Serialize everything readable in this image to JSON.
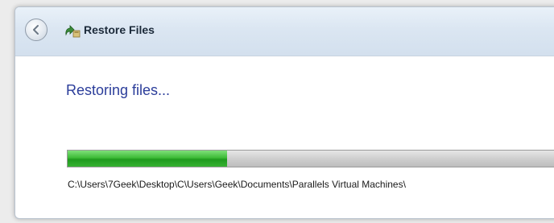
{
  "window": {
    "title": "Restore Files",
    "back_icon": "back-arrow-icon",
    "app_icon": "restore-files-icon"
  },
  "main": {
    "heading": "Restoring files...",
    "progress": 0.31,
    "current_path": "C:\\Users\\7Geek\\Desktop\\C\\Users\\Geek\\Documents\\Parallels Virtual Machines\\"
  },
  "colors": {
    "heading": "#2b3d9a",
    "progress_green": "#3dbb37"
  }
}
